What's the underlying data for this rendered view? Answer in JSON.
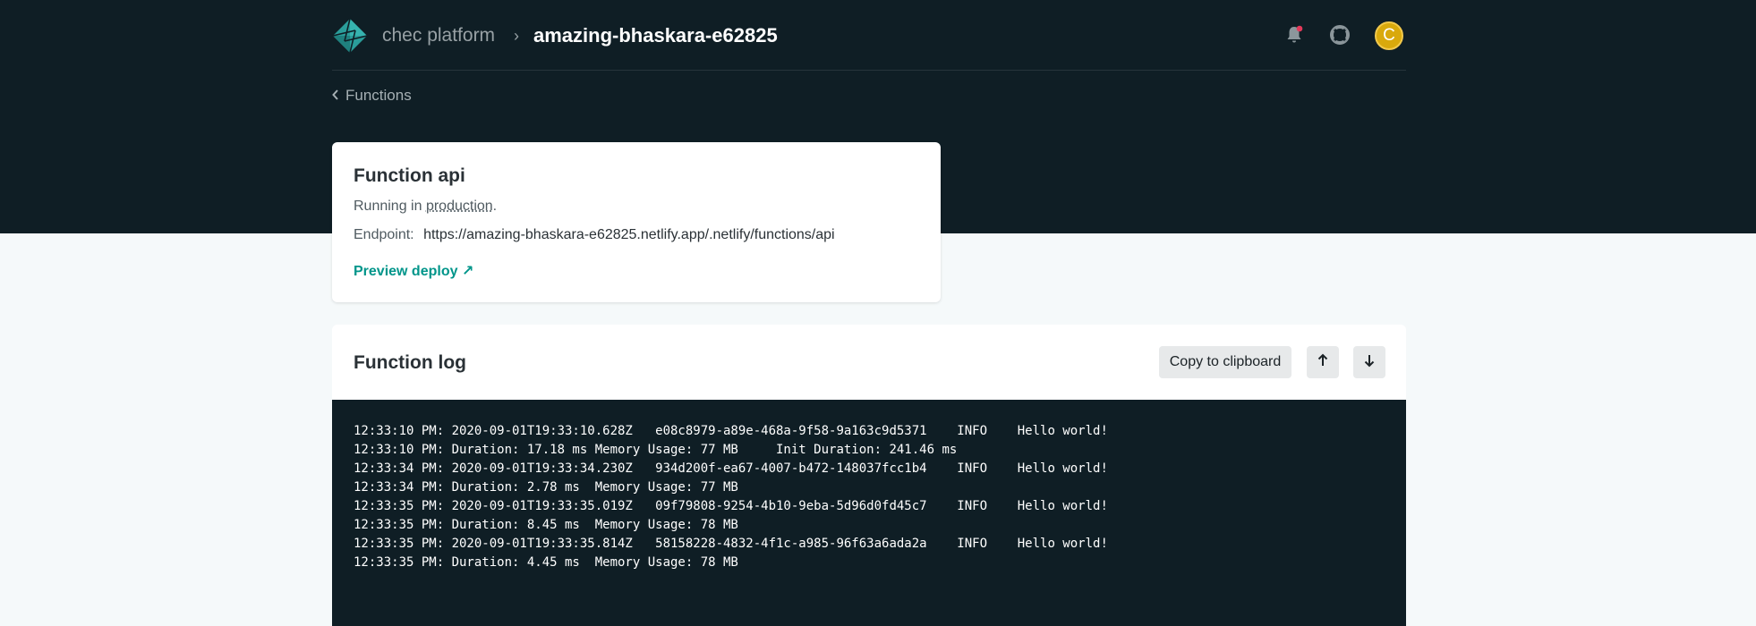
{
  "colors": {
    "header_bg": "#0f1e25",
    "accent": "#00958a",
    "avatar": "#d9a90c",
    "notification_dot": "#e4395a"
  },
  "header": {
    "team": "chec platform",
    "separator": "›",
    "site": "amazing-bhaskara-e62825",
    "icons": [
      "logo-icon",
      "bell-icon",
      "help-icon"
    ],
    "avatar_initial": "C"
  },
  "back": {
    "label": "Functions"
  },
  "function": {
    "title": "Function api",
    "running_prefix": "Running in ",
    "environment": "production",
    "running_suffix": ".",
    "endpoint_label": "Endpoint:",
    "endpoint_url": "https://amazing-bhaskara-e62825.netlify.app/.netlify/functions/api",
    "preview_label": "Preview deploy ↗"
  },
  "log": {
    "title": "Function log",
    "copy_label": "Copy to clipboard",
    "up_icon": "arrow-up-icon",
    "down_icon": "arrow-down-icon",
    "lines": [
      "12:33:10 PM: 2020-09-01T19:33:10.628Z   e08c8979-a89e-468a-9f58-9a163c9d5371    INFO    Hello world!",
      "12:33:10 PM: Duration: 17.18 ms Memory Usage: 77 MB     Init Duration: 241.46 ms",
      "12:33:34 PM: 2020-09-01T19:33:34.230Z   934d200f-ea67-4007-b472-148037fcc1b4    INFO    Hello world!",
      "12:33:34 PM: Duration: 2.78 ms  Memory Usage: 77 MB",
      "12:33:35 PM: 2020-09-01T19:33:35.019Z   09f79808-9254-4b10-9eba-5d96d0fd45c7    INFO    Hello world!",
      "12:33:35 PM: Duration: 8.45 ms  Memory Usage: 78 MB",
      "12:33:35 PM: 2020-09-01T19:33:35.814Z   58158228-4832-4f1c-a985-96f63a6ada2a    INFO    Hello world!",
      "12:33:35 PM: Duration: 4.45 ms  Memory Usage: 78 MB"
    ]
  }
}
